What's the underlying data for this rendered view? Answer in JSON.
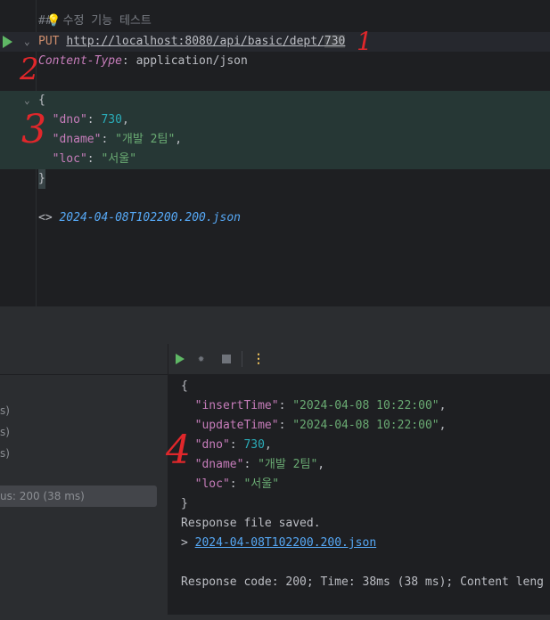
{
  "editor": {
    "comment_prefix": "##",
    "comment_icon": "lightbulb-icon",
    "comment_text": " 수정 기능 테스트",
    "method": "PUT",
    "url_main": "http://localhost:8080/api/basic/dept/",
    "url_tail": "730",
    "header_name": "Content-Type",
    "header_sep": ": ",
    "header_value": "application/json",
    "body_open": "{",
    "body_close": "}",
    "fields": [
      {
        "key": "\"dno\"",
        "sep": ": ",
        "value": "730",
        "end": ","
      },
      {
        "key": "\"dname\"",
        "sep": ": ",
        "value": "\"개발 2팀\"",
        "end": ","
      },
      {
        "key": "\"loc\"",
        "sep": ": ",
        "value": "\"서울\"",
        "end": ""
      }
    ],
    "response_ref_prefix": "<> ",
    "response_ref_file": "2024-04-08T102200.200.json"
  },
  "services_panel": {
    "rows": [
      "s)",
      "s)",
      "s)"
    ],
    "status_row": "us: 200 (38 ms)"
  },
  "run_output": {
    "open": "{",
    "fields": [
      {
        "key": "\"insertTime\"",
        "sep": ": ",
        "value": "\"2024-04-08 10:22:00\"",
        "end": ","
      },
      {
        "key": "\"updateTime\"",
        "sep": ": ",
        "value": "\"2024-04-08 10:22:00\"",
        "end": ","
      },
      {
        "key": "\"dno\"",
        "sep": ": ",
        "value": "730",
        "end": ","
      },
      {
        "key": "\"dname\"",
        "sep": ": ",
        "value": "\"개발 2팀\"",
        "end": ","
      },
      {
        "key": "\"loc\"",
        "sep": ": ",
        "value": "\"서울\"",
        "end": ""
      }
    ],
    "close": "}",
    "saved_msg": "Response file saved.",
    "link_prefix": "> ",
    "link_file": "2024-04-08T102200.200.json",
    "summary": "Response code: 200; Time: 38ms (38 ms); Content leng"
  },
  "annotations": [
    "1",
    "2",
    "3",
    "4"
  ]
}
